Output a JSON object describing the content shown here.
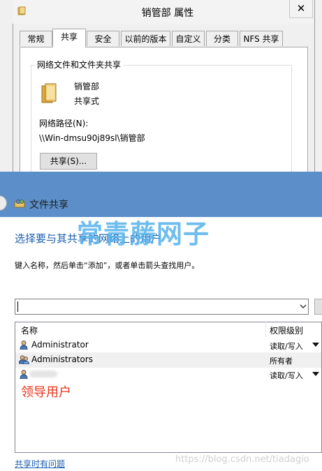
{
  "properties_dialog": {
    "title": "销管部 属性",
    "close_glyph": "✕",
    "tabs": [
      {
        "label": "常规",
        "active": false
      },
      {
        "label": "共享",
        "active": true
      },
      {
        "label": "安全",
        "active": false
      },
      {
        "label": "以前的版本",
        "active": false
      },
      {
        "label": "自定义",
        "active": false
      },
      {
        "label": "分类",
        "active": false
      },
      {
        "label": "NFS 共享",
        "active": false
      }
    ],
    "group_label": "网络文件和文件夹共享",
    "folder_name": "销管部",
    "folder_status": "共享式",
    "network_path_label": "网络路径(N):",
    "network_path": "\\\\Win-dmsu90j89sl\\销管部",
    "share_button": "共享(S)..."
  },
  "wizard": {
    "title": "文件共享",
    "heading": "选择要与其共享的网络上的用户",
    "instruction": "键入名称，然后单击“添加”，或者单击箭头查找用户。",
    "input_value": "",
    "columns": {
      "name": "名称",
      "level": "权限级别"
    },
    "rows": [
      {
        "name": "Administrator",
        "level": "读取/写入",
        "has_dropdown": true,
        "icon": "user-icon"
      },
      {
        "name": "Administrators",
        "level": "所有者",
        "has_dropdown": false,
        "icon": "group-icon"
      },
      {
        "name": "",
        "level": "读取/写入",
        "has_dropdown": true,
        "icon": "user-icon"
      }
    ],
    "help_link": "共享时有问题"
  },
  "overlays": {
    "watermark": "常青藤网子",
    "annotation": "领导用户",
    "csdn_watermark": "https://blog.csdn.net/tiadagio"
  },
  "colors": {
    "header_blue": "#5c8fca",
    "link_blue": "#1b5fb0",
    "annotation_red": "#e8341c",
    "watermark_blue": "#55b2ec"
  }
}
